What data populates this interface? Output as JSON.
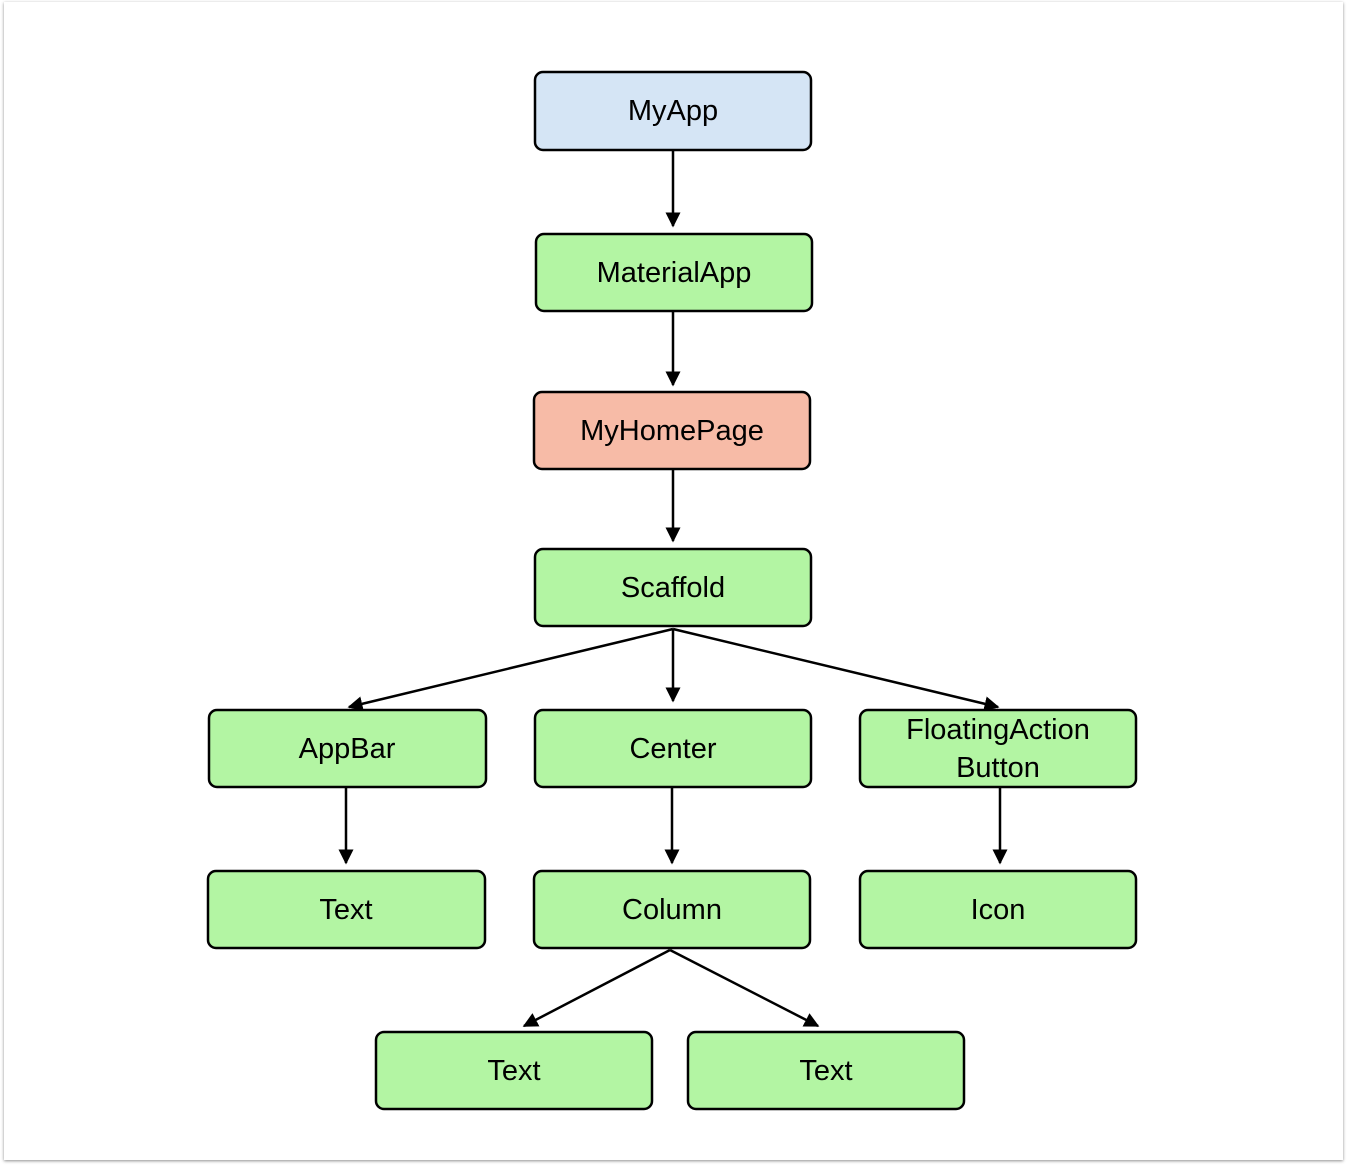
{
  "colors": {
    "root": "#d5e5f5",
    "widget": "#b3f5a3",
    "stateful": "#f7bba7",
    "stroke": "#000000"
  },
  "nodes": [
    {
      "label": "MyApp",
      "color": "#d5e5f5"
    },
    {
      "label": "MaterialApp",
      "color": "#b3f5a3"
    },
    {
      "label": "MyHomePage",
      "color": "#f7bba7"
    },
    {
      "label": "Scaffold",
      "color": "#b3f5a3"
    },
    {
      "label": "AppBar",
      "color": "#b3f5a3"
    },
    {
      "label": "Center",
      "color": "#b3f5a3"
    },
    {
      "label_lines": [
        "FloatingAction",
        "Button"
      ],
      "color": "#b3f5a3"
    },
    {
      "label": "Text",
      "color": "#b3f5a3"
    },
    {
      "label": "Column",
      "color": "#b3f5a3"
    },
    {
      "label": "Icon",
      "color": "#b3f5a3"
    },
    {
      "label": "Text",
      "color": "#b3f5a3"
    },
    {
      "label": "Text",
      "color": "#b3f5a3"
    }
  ],
  "edges": [
    [
      0,
      1
    ],
    [
      1,
      2
    ],
    [
      2,
      3
    ],
    [
      3,
      4
    ],
    [
      3,
      5
    ],
    [
      3,
      6
    ],
    [
      4,
      7
    ],
    [
      5,
      8
    ],
    [
      6,
      9
    ],
    [
      8,
      10
    ],
    [
      8,
      11
    ]
  ]
}
